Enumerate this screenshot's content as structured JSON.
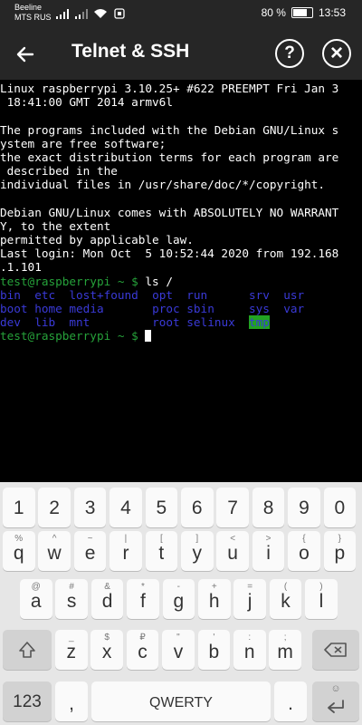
{
  "status_bar": {
    "carrier_line1": "Beeline",
    "carrier_line2": "MTS RUS",
    "battery_text": "80 %",
    "battery_level": 0.8,
    "time": "13:53"
  },
  "app_bar": {
    "back_icon": "arrow-left",
    "title": "Telnet & SSH",
    "help_label": "?",
    "close_label": "×"
  },
  "terminal": {
    "lines": [
      "Linux raspberrypi 3.10.25+ #622 PREEMPT Fri Jan 3",
      " 18:41:00 GMT 2014 armv6l",
      "",
      "The programs included with the Debian GNU/Linux s",
      "ystem are free software;",
      "the exact distribution terms for each program are",
      " described in the",
      "individual files in /usr/share/doc/*/copyright.",
      "",
      "Debian GNU/Linux comes with ABSOLUTELY NO WARRANT",
      "Y, to the extent",
      "permitted by applicable law.",
      "Last login: Mon Oct  5 10:52:44 2020 from 192.168",
      ".1.101"
    ],
    "prompt": "test@raspberrypi ~ $",
    "command": "ls /",
    "ls_rows": [
      [
        "bin ",
        "etc ",
        "lost+found ",
        "opt ",
        "run     ",
        "srv ",
        "usr"
      ],
      [
        "boot",
        "home",
        "media      ",
        "proc",
        "sbin    ",
        "sys ",
        "var"
      ],
      [
        "dev ",
        "lib ",
        "mnt        ",
        "root",
        "selinux ",
        "tmp",
        ""
      ]
    ],
    "highlighted_entry": "tmp",
    "prompt2": "test@raspberrypi ~ $"
  },
  "keyboard": {
    "number_row": [
      "1",
      "2",
      "3",
      "4",
      "5",
      "6",
      "7",
      "8",
      "9",
      "0"
    ],
    "row1": [
      {
        "main": "q",
        "hint": "%"
      },
      {
        "main": "w",
        "hint": "^"
      },
      {
        "main": "e",
        "hint": "~"
      },
      {
        "main": "r",
        "hint": "|"
      },
      {
        "main": "t",
        "hint": "["
      },
      {
        "main": "y",
        "hint": "]"
      },
      {
        "main": "u",
        "hint": "<"
      },
      {
        "main": "i",
        "hint": ">"
      },
      {
        "main": "o",
        "hint": "{"
      },
      {
        "main": "p",
        "hint": "}"
      }
    ],
    "row2": [
      {
        "main": "a",
        "hint": "@"
      },
      {
        "main": "s",
        "hint": "#"
      },
      {
        "main": "d",
        "hint": "&"
      },
      {
        "main": "f",
        "hint": "*"
      },
      {
        "main": "g",
        "hint": "-"
      },
      {
        "main": "h",
        "hint": "+"
      },
      {
        "main": "j",
        "hint": "="
      },
      {
        "main": "k",
        "hint": "("
      },
      {
        "main": "l",
        "hint": ")"
      }
    ],
    "row3": [
      {
        "main": "z",
        "hint": "_"
      },
      {
        "main": "x",
        "hint": "$"
      },
      {
        "main": "c",
        "hint": "₽"
      },
      {
        "main": "v",
        "hint": "\""
      },
      {
        "main": "b",
        "hint": "'"
      },
      {
        "main": "n",
        "hint": ":"
      },
      {
        "main": "m",
        "hint": ";"
      }
    ],
    "shift_icon": "shift-arrow-icon",
    "backspace_icon": "backspace-icon",
    "symbols_label": "123",
    "comma_label": ",",
    "space_label": "QWERTY",
    "period_label": ".",
    "enter_hint": "☺",
    "enter_icon": "enter-icon"
  }
}
